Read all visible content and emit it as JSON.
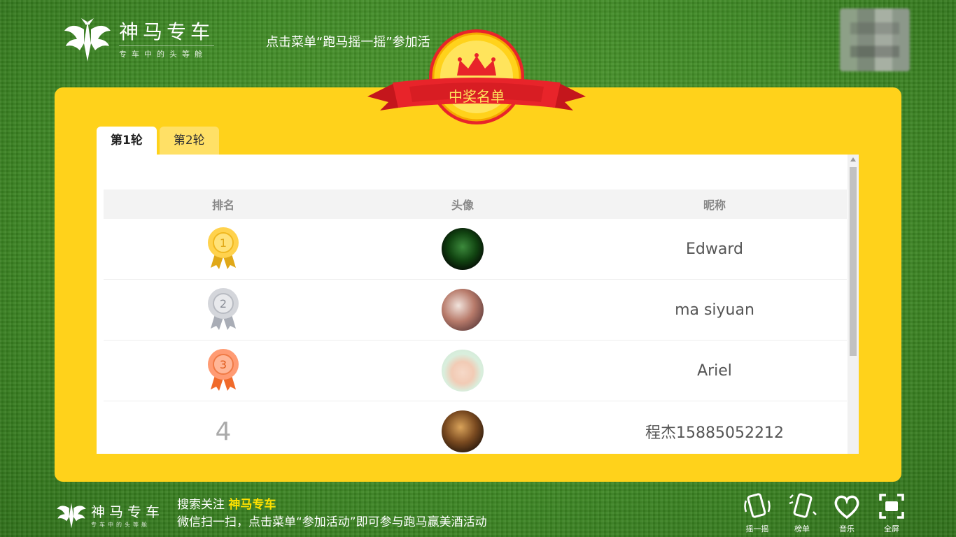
{
  "header": {
    "brand_name": "神马专车",
    "slogan": "专车中的头等舱",
    "notice": "点击菜单“跑马摇一摇”参加活"
  },
  "panel": {
    "banner_title": "中奖名单",
    "tabs": [
      {
        "label": "第1轮",
        "active": true
      },
      {
        "label": "第2轮",
        "active": false
      }
    ],
    "columns": {
      "rank": "排名",
      "avatar": "头像",
      "nickname": "昵称"
    },
    "rows": [
      {
        "rank": "1",
        "nickname": "Edward",
        "medal": "gold"
      },
      {
        "rank": "2",
        "nickname": "ma siyuan",
        "medal": "silver"
      },
      {
        "rank": "3",
        "nickname": "Ariel",
        "medal": "bronze"
      },
      {
        "rank": "4",
        "nickname": "程杰15885052212",
        "medal": null
      }
    ]
  },
  "footer": {
    "brand_name": "神马专车",
    "slogan": "专车中的头等舱",
    "line1_prefix": "搜索关注 ",
    "line1_highlight": "神马专车",
    "line2": "微信扫一扫，点击菜单“参加活动”即可参与跑马赢美酒活动",
    "icons": [
      {
        "label": "摇一摇",
        "icon": "shake-phone-icon"
      },
      {
        "label": "榜单",
        "icon": "ranking-phone-icon"
      },
      {
        "label": "音乐",
        "icon": "music-heart-icon"
      },
      {
        "label": "全屏",
        "icon": "fullscreen-icon"
      }
    ]
  },
  "colors": {
    "panel": "#ffd21b",
    "banner_red": "#e8242a",
    "highlight": "#ffe100"
  }
}
